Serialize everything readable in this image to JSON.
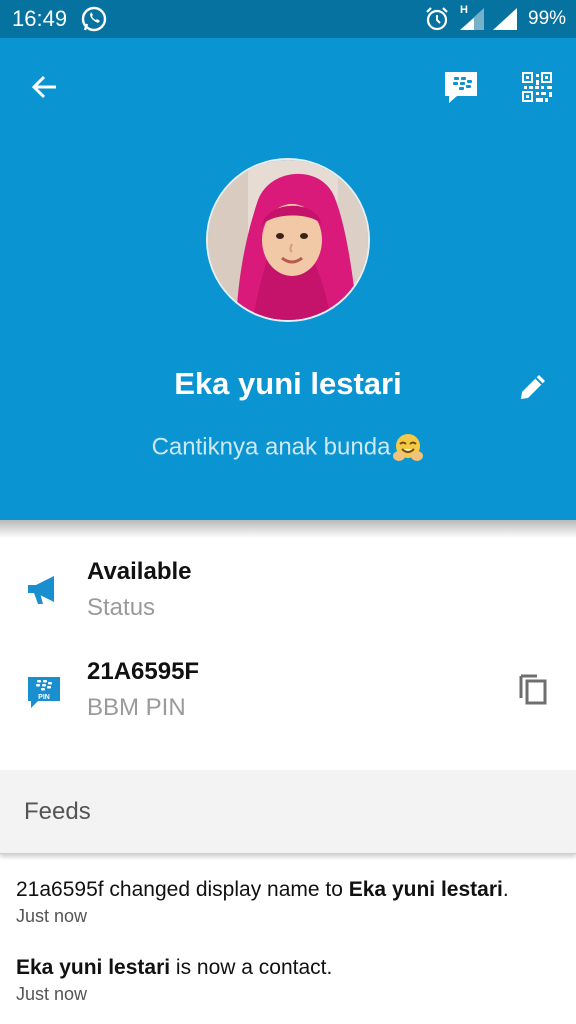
{
  "status_bar": {
    "time": "16:49",
    "network_label": "H",
    "battery": "99%"
  },
  "profile": {
    "display_name": "Eka yuni lestari",
    "status_message": "Cantiknya anak bunda"
  },
  "info": {
    "availability": "Available",
    "availability_caption": "Status",
    "pin": "21A6595F",
    "pin_caption": "BBM PIN",
    "pin_badge": "PIN"
  },
  "feeds": {
    "header": "Feeds",
    "items": [
      {
        "prefix": "21a6595f changed display name to ",
        "bold": "Eka yuni lestari",
        "suffix": ".",
        "time": "Just now"
      },
      {
        "bold": "Eka yuni lestari",
        "suffix": " is now a contact.",
        "time": "Just now"
      }
    ]
  },
  "colors": {
    "header_blue": "#0a95d2",
    "status_bar_blue": "#06729f",
    "accent_icon_blue": "#1a8fd0"
  },
  "icons": {
    "back": "arrow-back-icon",
    "chat": "bbm-chat-icon",
    "qr": "qr-code-icon",
    "edit": "pencil-icon",
    "status": "megaphone-icon",
    "pin": "bbm-pin-icon",
    "copy": "copy-icon"
  }
}
